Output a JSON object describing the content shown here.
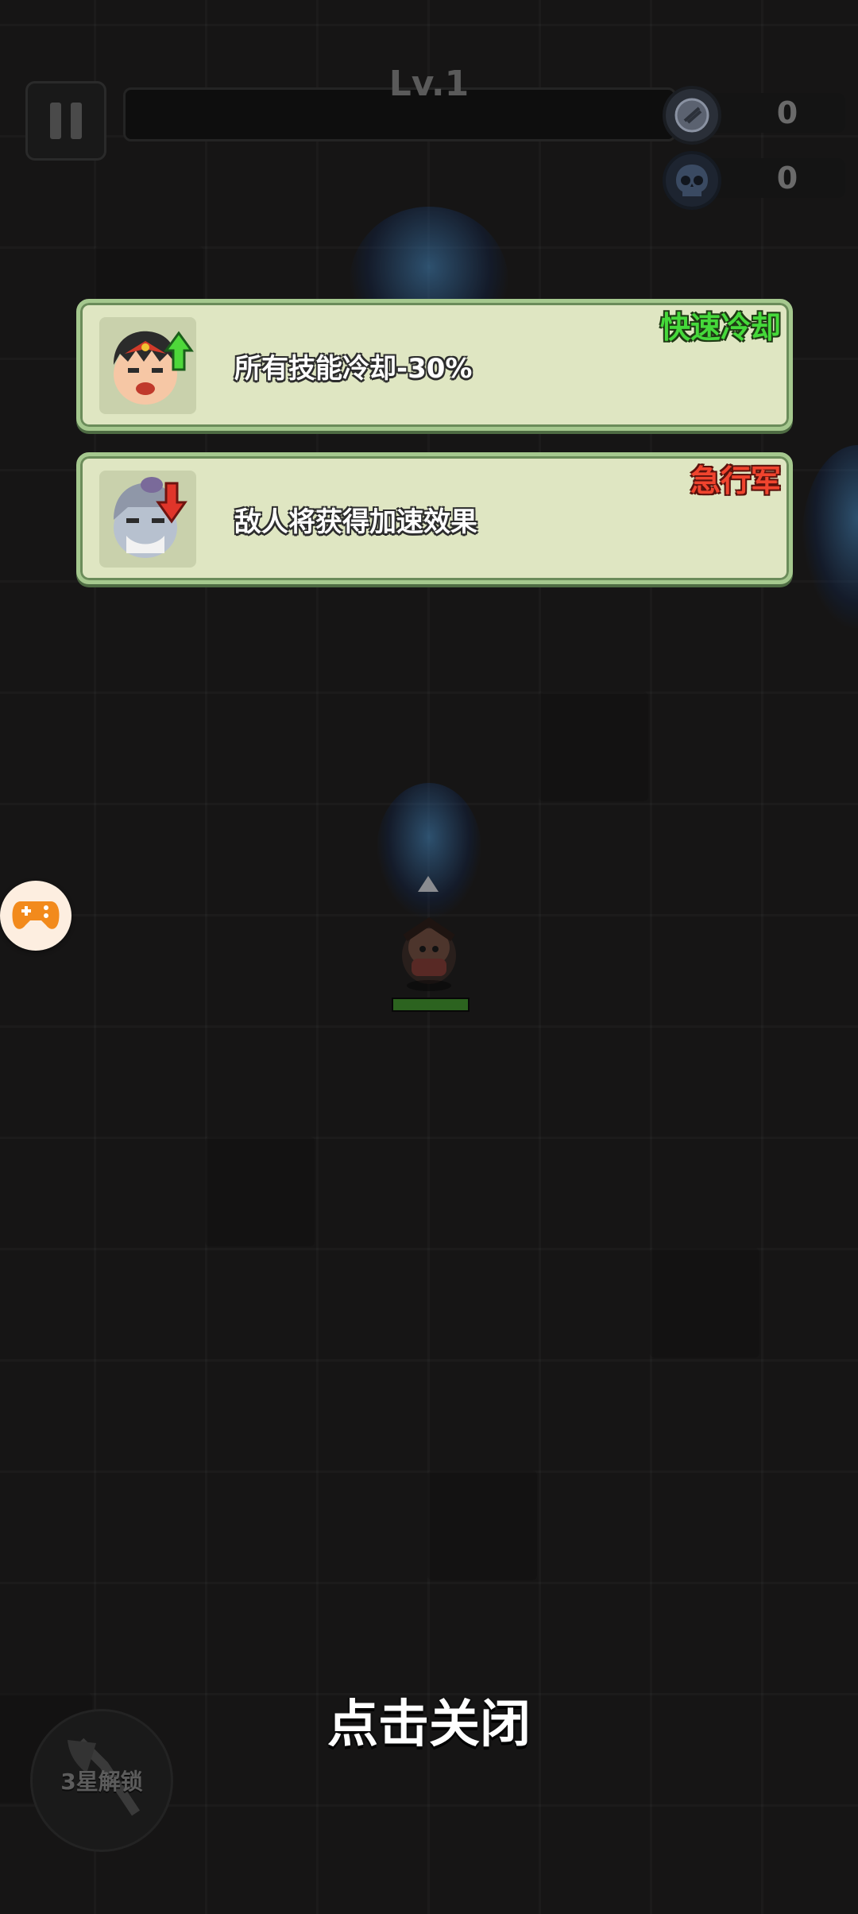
{
  "hud": {
    "level_label": "Lv.1",
    "coin_count": "0",
    "kill_count": "0"
  },
  "cards": [
    {
      "title": "快速冷却",
      "title_color": "#45d93a",
      "description": "所有技能冷却-30%",
      "portrait_icon": "hero-portrait-up-arrow-icon"
    },
    {
      "title": "急行军",
      "title_color": "#f0442e",
      "description": "敌人将获得加速效果",
      "portrait_icon": "enemy-portrait-down-arrow-icon"
    }
  ],
  "close_prompt": "点击关闭",
  "skill_slot": {
    "label": "3星解锁"
  },
  "float_button_icon": "gamepad-icon",
  "player": {
    "hp_fraction": 1.0
  }
}
